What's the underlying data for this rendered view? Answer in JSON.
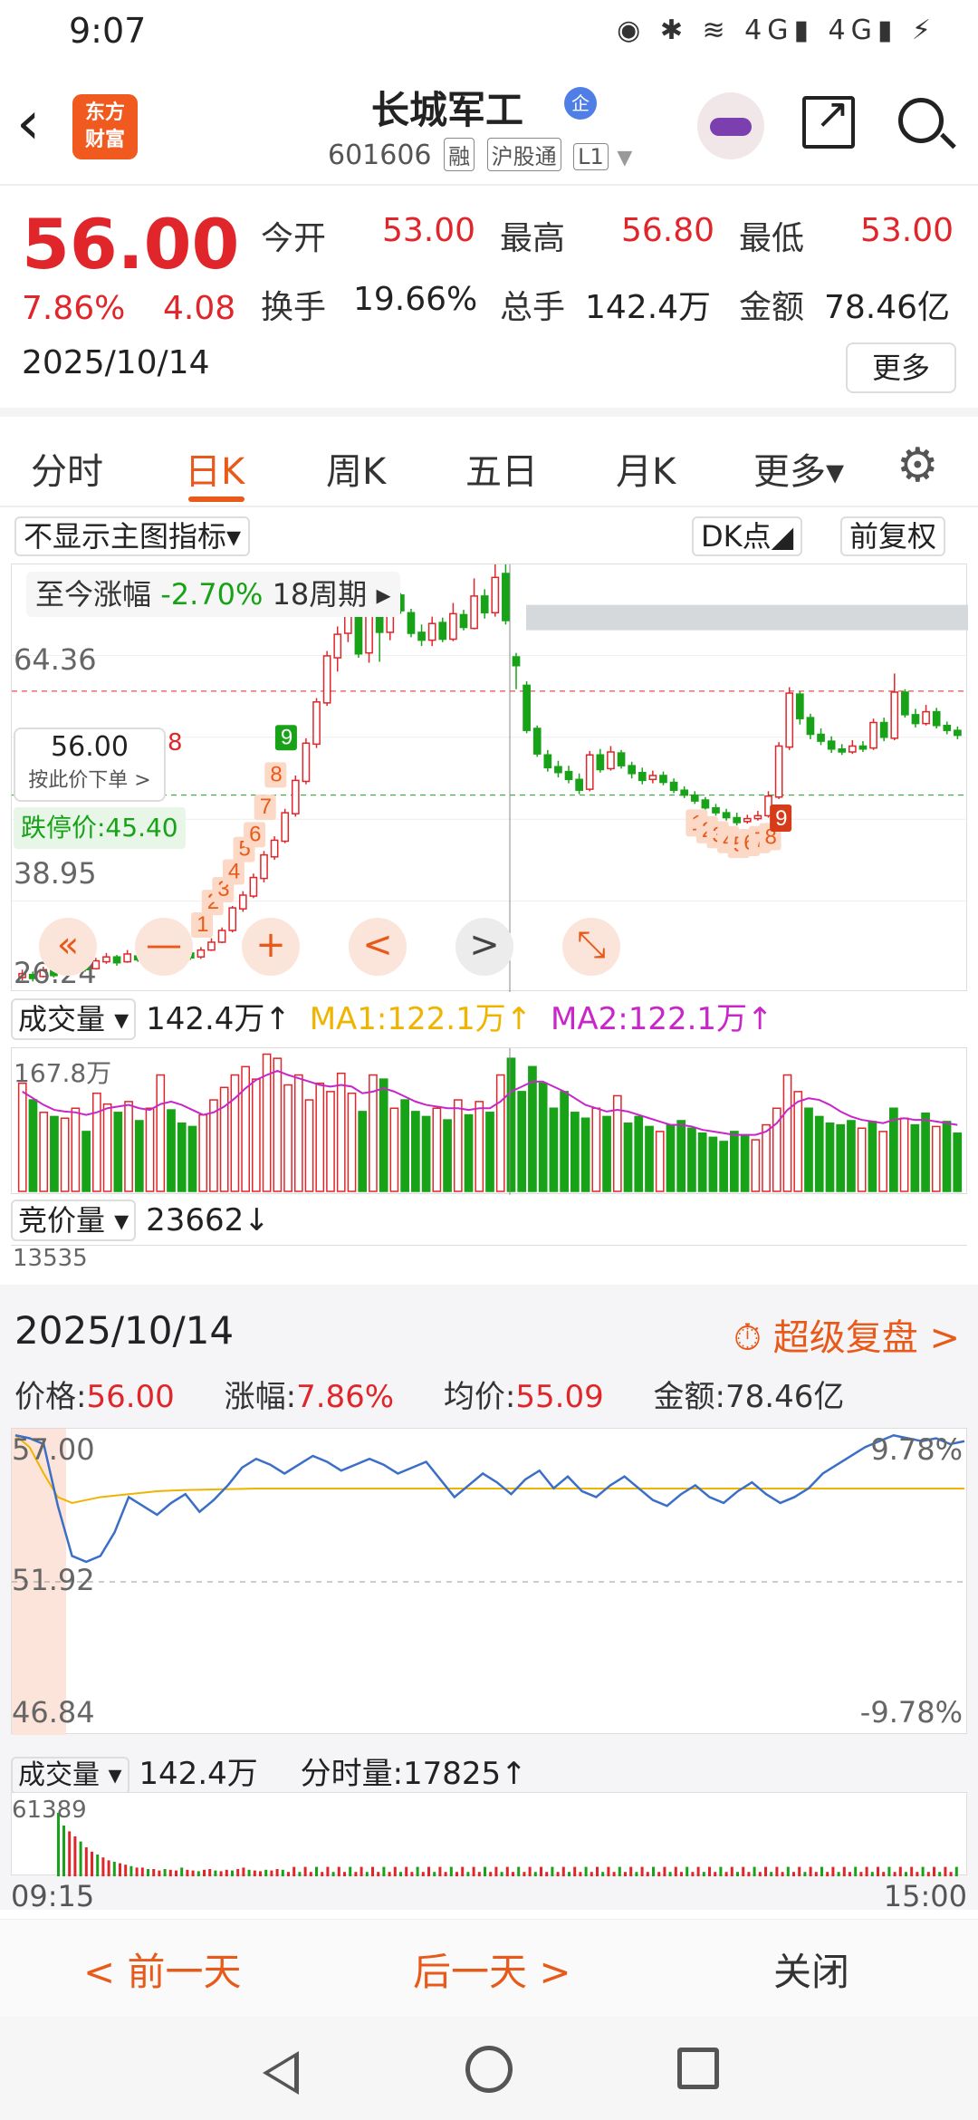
{
  "status_bar": {
    "time": "9:07",
    "icons": "◉ ✱ ≋ 4G▮ 4G▮ ⚡"
  },
  "header": {
    "logo_top": "东方",
    "logo_bottom": "财富",
    "stock_name": "长城军工",
    "name_badge": "企",
    "stock_code": "601606",
    "chips": [
      "融",
      "沪股通",
      "L1"
    ]
  },
  "quote": {
    "price": "56.00",
    "change_pct": "7.86%",
    "change_amt": "4.08",
    "date": "2025/10/14",
    "open_label": "今开",
    "open": "53.00",
    "high_label": "最高",
    "high": "56.80",
    "low_label": "最低",
    "low": "53.00",
    "turnover_label": "换手",
    "turnover": "19.66%",
    "volume_label": "总手",
    "volume": "142.4万",
    "amount_label": "金额",
    "amount": "78.46亿",
    "more_label": "更多"
  },
  "tabs": [
    "分时",
    "日K",
    "周K",
    "五日",
    "月K",
    "更多▾"
  ],
  "active_tab": "日K",
  "chart_toolbar": {
    "indicator_select": "不显示主图指标▾",
    "dk_point": "DK点◢",
    "adjust": "前复权"
  },
  "kline": {
    "range_label": "至今涨幅",
    "range_pct": "-2.70%",
    "range_period": "18周期 ▸",
    "y_top": "64.36",
    "y_mid": "38.95",
    "y_bottom": "26.24",
    "crosshair_price": "56.00",
    "crosshair_hint": "按此价下单 >",
    "crosshair_marker": "8",
    "limit_down_label": "跌停价:45.40",
    "controls": [
      "«",
      "—",
      "+",
      "<",
      ">",
      "⤡"
    ]
  },
  "volume_row": {
    "select": "成交量 ▾",
    "value": "142.4万↑",
    "ma1": "MA1:122.1万↑",
    "ma2": "MA2:122.1万↑",
    "y_top": "167.8万"
  },
  "bid_row": {
    "select": "竞价量 ▾",
    "value": "23662↓",
    "y_top": "13535"
  },
  "replay": {
    "date": "2025/10/14",
    "super_label": "超级复盘 >",
    "price_label": "价格:",
    "price": "56.00",
    "pct_label": "涨幅:",
    "pct": "7.86%",
    "avg_label": "均价:",
    "avg": "55.09",
    "amount_label": "金额:",
    "amount": "78.46亿",
    "y_top": "57.00",
    "y_mid": "51.92",
    "y_bottom": "46.84",
    "pct_top": "9.78%",
    "pct_bottom": "-9.78%",
    "vol_select": "成交量 ▾",
    "vol_value": "142.4万",
    "tick_vol": "分时量:17825↑",
    "vol_y_top": "61389",
    "time_start": "09:15",
    "time_end": "15:00"
  },
  "bottom": {
    "prev": "< 前一天",
    "next": "后一天 >",
    "close": "关闭"
  },
  "colors": {
    "up": "#e0262a",
    "down": "#18a218",
    "accent": "#e85a1a",
    "ma1": "#f0b400",
    "ma2": "#c826c8",
    "intraday": "#3b6fc7"
  },
  "chart_data": [
    {
      "type": "candlestick",
      "title": "长城军工 日K",
      "ylim": [
        26.24,
        68
      ],
      "candles": [
        {
          "o": 26.8,
          "c": 27.2,
          "h": 27.6,
          "l": 26.5
        },
        {
          "o": 27.1,
          "c": 26.7,
          "h": 27.4,
          "l": 26.4
        },
        {
          "o": 26.9,
          "c": 27.6,
          "h": 27.9,
          "l": 26.8
        },
        {
          "o": 27.5,
          "c": 27.0,
          "h": 27.8,
          "l": 26.8
        },
        {
          "o": 27.2,
          "c": 27.9,
          "h": 28.2,
          "l": 27.1
        },
        {
          "o": 27.8,
          "c": 28.1,
          "h": 28.5,
          "l": 27.6
        },
        {
          "o": 28.0,
          "c": 27.6,
          "h": 28.3,
          "l": 27.4
        },
        {
          "o": 27.7,
          "c": 28.5,
          "h": 28.8,
          "l": 27.6
        },
        {
          "o": 28.4,
          "c": 28.9,
          "h": 29.3,
          "l": 28.2
        },
        {
          "o": 28.9,
          "c": 28.3,
          "h": 29.1,
          "l": 28.0
        },
        {
          "o": 28.4,
          "c": 29.2,
          "h": 29.6,
          "l": 28.3
        },
        {
          "o": 29.0,
          "c": 28.6,
          "h": 29.3,
          "l": 28.4
        },
        {
          "o": 28.7,
          "c": 29.5,
          "h": 29.8,
          "l": 28.5
        },
        {
          "o": 29.5,
          "c": 30.9,
          "h": 31.2,
          "l": 29.4
        },
        {
          "o": 30.8,
          "c": 29.9,
          "h": 31.0,
          "l": 29.7
        },
        {
          "o": 29.9,
          "c": 29.2,
          "h": 30.2,
          "l": 29.0
        },
        {
          "o": 29.3,
          "c": 28.8,
          "h": 29.5,
          "l": 28.6
        },
        {
          "o": 28.9,
          "c": 29.6,
          "h": 29.9,
          "l": 28.7
        },
        {
          "o": 29.6,
          "c": 30.4,
          "h": 30.8,
          "l": 29.5
        },
        {
          "o": 30.4,
          "c": 31.6,
          "h": 31.9,
          "l": 30.3
        },
        {
          "o": 31.6,
          "c": 33.9,
          "h": 34.1,
          "l": 31.4
        },
        {
          "o": 33.8,
          "c": 35.2,
          "h": 35.6,
          "l": 33.5
        },
        {
          "o": 35.1,
          "c": 37.0,
          "h": 37.4,
          "l": 34.9
        },
        {
          "o": 36.9,
          "c": 39.3,
          "h": 39.7,
          "l": 36.5
        },
        {
          "o": 39.1,
          "c": 40.8,
          "h": 41.2,
          "l": 38.8
        },
        {
          "o": 40.7,
          "c": 43.6,
          "h": 44.0,
          "l": 40.5
        },
        {
          "o": 43.5,
          "c": 46.9,
          "h": 47.4,
          "l": 43.2
        },
        {
          "o": 46.8,
          "c": 50.7,
          "h": 51.2,
          "l": 46.5
        },
        {
          "o": 50.6,
          "c": 54.9,
          "h": 55.3,
          "l": 50.2
        },
        {
          "o": 54.8,
          "c": 59.6,
          "h": 60.1,
          "l": 54.5
        },
        {
          "o": 59.4,
          "c": 61.8,
          "h": 62.6,
          "l": 58.0
        },
        {
          "o": 61.9,
          "c": 64.8,
          "h": 67.2,
          "l": 61.0
        },
        {
          "o": 64.7,
          "c": 59.8,
          "h": 65.4,
          "l": 59.4
        },
        {
          "o": 59.9,
          "c": 63.9,
          "h": 65.0,
          "l": 58.9
        },
        {
          "o": 63.9,
          "c": 62.0,
          "h": 65.0,
          "l": 59.0
        },
        {
          "o": 62.0,
          "c": 65.8,
          "h": 66.3,
          "l": 61.2
        },
        {
          "o": 65.8,
          "c": 64.2,
          "h": 66.0,
          "l": 63.9
        },
        {
          "o": 64.0,
          "c": 61.9,
          "h": 64.4,
          "l": 61.5
        },
        {
          "o": 62.0,
          "c": 61.2,
          "h": 62.8,
          "l": 60.6
        },
        {
          "o": 61.2,
          "c": 62.9,
          "h": 63.6,
          "l": 60.6
        },
        {
          "o": 63.0,
          "c": 61.3,
          "h": 63.5,
          "l": 61.0
        },
        {
          "o": 61.3,
          "c": 63.9,
          "h": 65.0,
          "l": 61.1
        },
        {
          "o": 63.8,
          "c": 62.5,
          "h": 64.3,
          "l": 62.2
        },
        {
          "o": 62.4,
          "c": 65.7,
          "h": 67.5,
          "l": 62.3
        },
        {
          "o": 65.7,
          "c": 64.0,
          "h": 66.4,
          "l": 63.4
        },
        {
          "o": 64.0,
          "c": 67.6,
          "h": 69.0,
          "l": 63.6
        },
        {
          "o": 68.0,
          "c": 63.2,
          "h": 70.5,
          "l": 62.8
        },
        {
          "o": 59.5,
          "c": 58.6,
          "h": 59.9,
          "l": 56.2
        },
        {
          "o": 56.6,
          "c": 52.0,
          "h": 57.0,
          "l": 51.7
        },
        {
          "o": 52.2,
          "c": 49.6,
          "h": 52.5,
          "l": 49.3
        },
        {
          "o": 49.5,
          "c": 48.2,
          "h": 50.0,
          "l": 47.8
        },
        {
          "o": 48.3,
          "c": 47.7,
          "h": 48.9,
          "l": 47.2
        },
        {
          "o": 47.8,
          "c": 47.0,
          "h": 48.4,
          "l": 46.6
        },
        {
          "o": 47.0,
          "c": 45.9,
          "h": 47.6,
          "l": 45.5
        },
        {
          "o": 46.0,
          "c": 49.5,
          "h": 49.9,
          "l": 45.8
        },
        {
          "o": 49.5,
          "c": 48.0,
          "h": 50.1,
          "l": 47.7
        },
        {
          "o": 48.1,
          "c": 49.8,
          "h": 50.4,
          "l": 47.9
        },
        {
          "o": 49.7,
          "c": 48.4,
          "h": 50.0,
          "l": 48.1
        },
        {
          "o": 48.4,
          "c": 47.6,
          "h": 48.8,
          "l": 47.1
        },
        {
          "o": 47.7,
          "c": 46.9,
          "h": 48.2,
          "l": 46.5
        },
        {
          "o": 47.0,
          "c": 47.4,
          "h": 47.9,
          "l": 46.6
        },
        {
          "o": 47.4,
          "c": 46.7,
          "h": 47.8,
          "l": 46.4
        },
        {
          "o": 46.7,
          "c": 45.9,
          "h": 47.1,
          "l": 45.6
        },
        {
          "o": 45.9,
          "c": 45.4,
          "h": 46.3,
          "l": 45.1
        },
        {
          "o": 45.4,
          "c": 44.8,
          "h": 45.8,
          "l": 44.5
        },
        {
          "o": 44.9,
          "c": 44.1,
          "h": 45.2,
          "l": 43.8
        },
        {
          "o": 44.1,
          "c": 43.6,
          "h": 44.5,
          "l": 43.3
        },
        {
          "o": 43.6,
          "c": 43.1,
          "h": 44.0,
          "l": 42.8
        },
        {
          "o": 43.1,
          "c": 42.6,
          "h": 43.6,
          "l": 42.3
        },
        {
          "o": 42.7,
          "c": 43.0,
          "h": 43.4,
          "l": 42.5
        },
        {
          "o": 43.0,
          "c": 43.3,
          "h": 43.8,
          "l": 42.8
        },
        {
          "o": 43.3,
          "c": 45.3,
          "h": 45.8,
          "l": 43.1
        },
        {
          "o": 45.2,
          "c": 50.4,
          "h": 50.8,
          "l": 45.0
        },
        {
          "o": 50.3,
          "c": 55.8,
          "h": 56.4,
          "l": 50.0
        },
        {
          "o": 55.7,
          "c": 53.2,
          "h": 56.0,
          "l": 52.6
        },
        {
          "o": 53.3,
          "c": 51.6,
          "h": 53.7,
          "l": 51.1
        },
        {
          "o": 51.6,
          "c": 50.9,
          "h": 52.2,
          "l": 50.5
        },
        {
          "o": 50.9,
          "c": 50.1,
          "h": 51.4,
          "l": 49.7
        },
        {
          "o": 50.1,
          "c": 49.8,
          "h": 50.6,
          "l": 49.5
        },
        {
          "o": 49.8,
          "c": 50.4,
          "h": 51.0,
          "l": 49.6
        },
        {
          "o": 50.4,
          "c": 50.1,
          "h": 50.9,
          "l": 49.8
        },
        {
          "o": 50.2,
          "c": 52.8,
          "h": 53.2,
          "l": 50.0
        },
        {
          "o": 52.8,
          "c": 51.3,
          "h": 53.3,
          "l": 50.9
        },
        {
          "o": 51.2,
          "c": 55.9,
          "h": 57.8,
          "l": 51.0
        },
        {
          "o": 55.9,
          "c": 53.6,
          "h": 56.2,
          "l": 53.3
        },
        {
          "o": 53.6,
          "c": 52.7,
          "h": 54.2,
          "l": 52.3
        },
        {
          "o": 52.7,
          "c": 53.9,
          "h": 54.6,
          "l": 52.5
        },
        {
          "o": 53.9,
          "c": 52.5,
          "h": 54.3,
          "l": 52.2
        },
        {
          "o": 52.5,
          "c": 52.0,
          "h": 52.9,
          "l": 51.6
        },
        {
          "o": 52.0,
          "c": 51.5,
          "h": 52.4,
          "l": 51.1
        }
      ],
      "td_up_labels": [
        "1",
        "2",
        "3",
        "4",
        "5",
        "6",
        "7",
        "8",
        "9"
      ],
      "td_down_labels": [
        "1",
        "2",
        "3",
        "4",
        "5",
        "6",
        "7",
        "8",
        "9"
      ]
    },
    {
      "type": "bar",
      "title": "成交量",
      "ylim": [
        0,
        167.8
      ],
      "values": [
        130,
        110,
        95,
        90,
        88,
        100,
        72,
        118,
        105,
        95,
        108,
        85,
        100,
        140,
        98,
        82,
        78,
        92,
        110,
        125,
        140,
        150,
        135,
        165,
        160,
        128,
        140,
        110,
        130,
        120,
        142,
        118,
        96,
        140,
        135,
        100,
        110,
        96,
        90,
        100,
        86,
        110,
        92,
        108,
        95,
        140,
        160,
        120,
        150,
        130,
        100,
        120,
        95,
        88,
        100,
        90,
        115,
        82,
        90,
        78,
        72,
        80,
        85,
        76,
        70,
        65,
        60,
        72,
        68,
        62,
        80,
        100,
        140,
        120,
        100,
        90,
        82,
        80,
        85,
        76,
        84,
        72,
        100,
        88,
        80,
        94,
        78,
        84,
        70
      ],
      "ma_values": [
        120,
        112,
        104,
        98,
        96,
        95,
        92,
        95,
        100,
        102,
        104,
        100,
        98,
        105,
        108,
        104,
        98,
        92,
        95,
        102,
        112,
        124,
        134,
        140,
        145,
        140,
        136,
        132,
        128,
        126,
        128,
        126,
        118,
        120,
        124,
        120,
        114,
        108,
        104,
        102,
        100,
        100,
        98,
        100,
        100,
        108,
        120,
        126,
        132,
        132,
        126,
        120,
        112,
        104,
        100,
        96,
        98,
        96,
        92,
        88,
        84,
        80,
        80,
        78,
        74,
        72,
        70,
        68,
        68,
        68,
        72,
        82,
        98,
        108,
        112,
        110,
        104,
        96,
        90,
        86,
        84,
        82,
        86,
        88,
        86,
        86,
        84,
        82,
        80
      ]
    },
    {
      "type": "line",
      "title": "分时",
      "ylim": [
        46.84,
        57.0
      ],
      "price": [
        56.9,
        56.8,
        56.6,
        54.5,
        52.8,
        52.6,
        52.8,
        53.6,
        54.8,
        54.5,
        54.2,
        54.6,
        54.9,
        54.3,
        54.7,
        55.2,
        55.8,
        56.1,
        55.9,
        55.6,
        55.9,
        56.2,
        56.0,
        55.7,
        55.9,
        56.1,
        55.9,
        55.6,
        55.8,
        56.0,
        55.4,
        54.8,
        55.2,
        55.6,
        55.3,
        54.9,
        55.4,
        55.7,
        55.1,
        55.5,
        55.0,
        54.8,
        55.2,
        55.5,
        55.1,
        54.7,
        54.5,
        54.9,
        55.2,
        54.8,
        54.6,
        55.0,
        55.3,
        54.9,
        54.6,
        54.8,
        55.1,
        55.6,
        55.9,
        56.2,
        56.5,
        56.7,
        56.9,
        56.8,
        56.7,
        56.8,
        56.6,
        56.7
      ],
      "avg": [
        56.9,
        56.5,
        55.6,
        54.8,
        54.6,
        54.7,
        54.8,
        54.85,
        54.9,
        54.95,
        55.0,
        55.02,
        55.04,
        55.05,
        55.06,
        55.07,
        55.08,
        55.09,
        55.09,
        55.09,
        55.09,
        55.09,
        55.09,
        55.09,
        55.09,
        55.09,
        55.09,
        55.09,
        55.09,
        55.09,
        55.09,
        55.09,
        55.09,
        55.09,
        55.09,
        55.09,
        55.09,
        55.09,
        55.09,
        55.09,
        55.09,
        55.09,
        55.09,
        55.09,
        55.09,
        55.09,
        55.09,
        55.09,
        55.09,
        55.09,
        55.09,
        55.09,
        55.09,
        55.09,
        55.09,
        55.09,
        55.09,
        55.09,
        55.09,
        55.09,
        55.09,
        55.09,
        55.09,
        55.09,
        55.09,
        55.09,
        55.09,
        55.09
      ]
    }
  ]
}
